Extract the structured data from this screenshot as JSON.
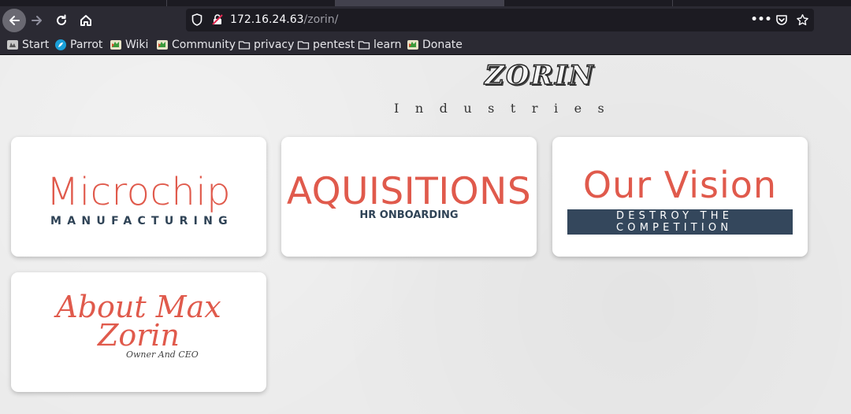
{
  "browser": {
    "url_host": "172.16.24.63",
    "url_path": "/zorin/",
    "menu_glyph": "•••"
  },
  "bookmarks": [
    {
      "label": "Start",
      "icon": "start-icon"
    },
    {
      "label": "Parrot",
      "icon": "parrot-icon"
    },
    {
      "label": "Wiki",
      "icon": "wiki-icon"
    },
    {
      "label": "Community",
      "icon": "community-icon"
    },
    {
      "label": "privacy",
      "icon": "folder-icon"
    },
    {
      "label": "pentest",
      "icon": "folder-icon"
    },
    {
      "label": "learn",
      "icon": "folder-icon"
    },
    {
      "label": "Donate",
      "icon": "donate-icon"
    }
  ],
  "page": {
    "logo": "ZORIN",
    "logo_subtitle": "Industries",
    "cards": [
      {
        "title": "Microchip",
        "subtitle": "MANUFACTURING"
      },
      {
        "title": "AQUISITIONS",
        "subtitle": "HR ONBOARDING"
      },
      {
        "title": "Our Vision",
        "band_line1": "DESTROY THE",
        "band_line2": "COMPETITION"
      },
      {
        "title_line1": "About Max",
        "title_line2": "Zorin",
        "subtitle": "Owner And CEO"
      }
    ]
  },
  "colors": {
    "accent": "#e05a4c",
    "navy": "#34475c",
    "toolbar": "#2b2a33"
  }
}
